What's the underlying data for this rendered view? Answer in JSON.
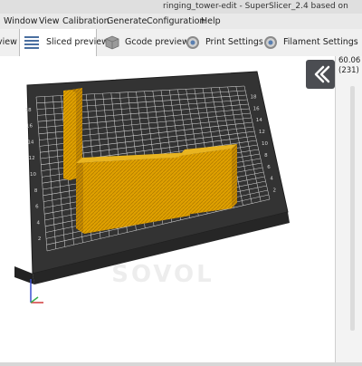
{
  "window": {
    "title": "ringing_tower-edit - SuperSlicer_2.4 based on"
  },
  "menu": [
    "Window",
    "View",
    "Calibration",
    "Generate",
    "Configuration",
    "Help"
  ],
  "tabs": [
    {
      "label": "view"
    },
    {
      "label": "Sliced preview"
    },
    {
      "label": "Gcode preview"
    },
    {
      "label": "Print Settings"
    },
    {
      "label": "Filament Settings"
    }
  ],
  "bed": {
    "logo": "SOVOL",
    "axis_ticks": [
      "2",
      "4",
      "6",
      "8",
      "10",
      "12",
      "14",
      "16",
      "18"
    ]
  },
  "layer_slider": {
    "top_height": "60.06",
    "top_layer": "(231)"
  },
  "colors": {
    "model": "#e0a100",
    "bed": "#333333",
    "accent": "#4b4d52"
  },
  "icons": {
    "collapse": "double-chevron-left-icon"
  }
}
